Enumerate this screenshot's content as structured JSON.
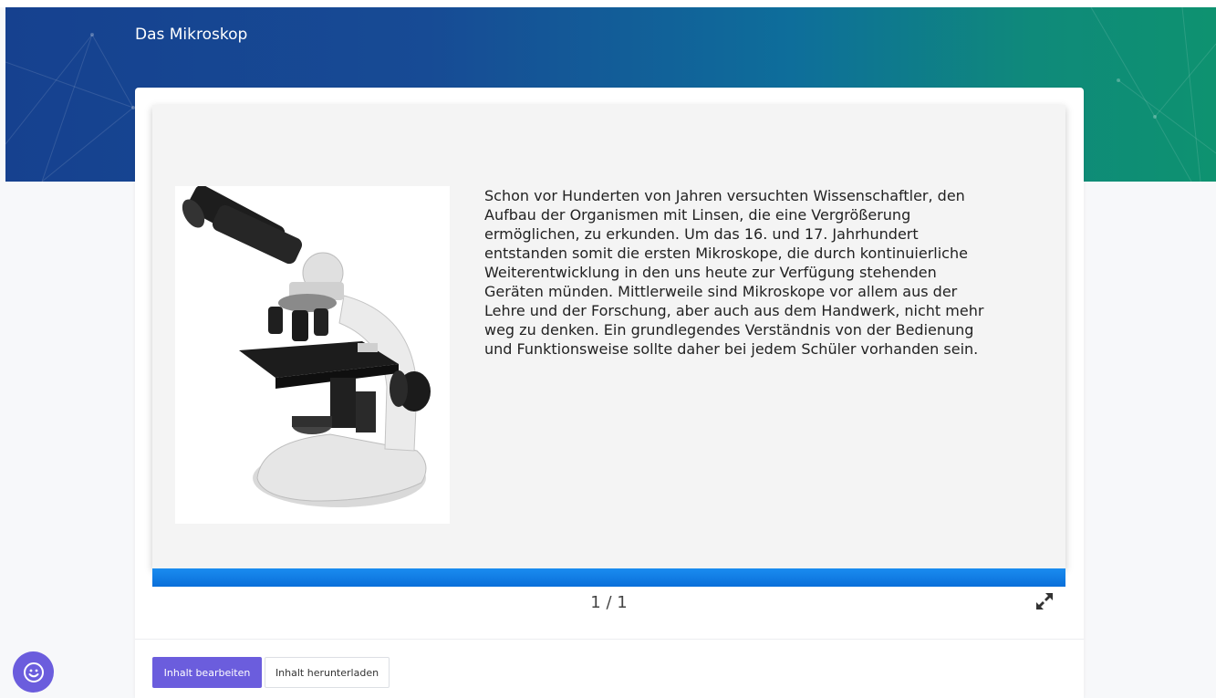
{
  "header": {
    "title": "Das Mikroskop"
  },
  "slide": {
    "image_alt": "microscope-image",
    "text": "Schon vor Hunderten von Jahren versuchten Wissenschaftler, den Aufbau der Organismen mit Linsen, die eine Vergrößerung ermöglichen, zu erkunden. Um das 16. und 17. Jahrhundert entstanden somit die ersten Mikroskope, die durch kontinuierliche Weiterentwicklung in den uns heute zur Verfügung stehenden Geräten münden. Mittlerweile sind Mikroskope vor allem aus der Lehre und der Forschung, aber auch aus dem Handwerk, nicht mehr weg zu denken. Ein grundlegendes Verständnis von der Bedienung und Funktionsweise sollte daher bei jedem Schüler vorhanden sein.",
    "page_counter": "1 / 1",
    "progress": 1.0
  },
  "actions": {
    "edit_label": "Inhalt bearbeiten",
    "download_label": "Inhalt herunterladen"
  },
  "icons": {
    "fullscreen": "fullscreen-expand-icon",
    "feedback": "smiley-icon"
  },
  "colors": {
    "accent": "#6b5ddd",
    "progress": "#1a8cf0",
    "hero_start": "#16418f",
    "hero_end": "#0e9270"
  }
}
